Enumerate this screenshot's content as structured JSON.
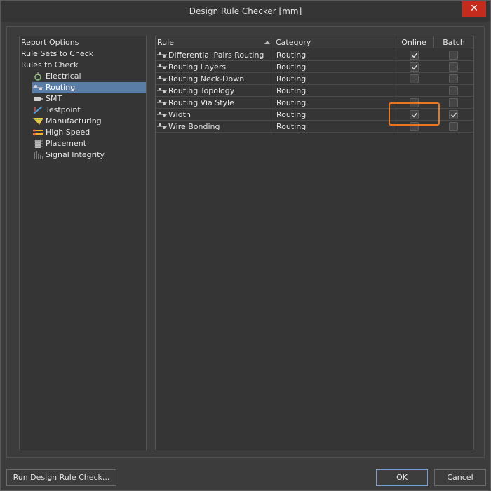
{
  "window": {
    "title": "Design Rule Checker [mm]",
    "close_label": "✕"
  },
  "tree": {
    "top_items": [
      {
        "label": "Report Options"
      },
      {
        "label": "Rule Sets to Check"
      },
      {
        "label": "Rules to Check"
      }
    ],
    "children": [
      {
        "label": "Electrical",
        "icon": "electrical-icon",
        "selected": false
      },
      {
        "label": "Routing",
        "icon": "routing-icon",
        "selected": true
      },
      {
        "label": "SMT",
        "icon": "smt-icon",
        "selected": false
      },
      {
        "label": "Testpoint",
        "icon": "testpoint-icon",
        "selected": false
      },
      {
        "label": "Manufacturing",
        "icon": "manufacturing-icon",
        "selected": false
      },
      {
        "label": "High Speed",
        "icon": "high-speed-icon",
        "selected": false
      },
      {
        "label": "Placement",
        "icon": "placement-icon",
        "selected": false
      },
      {
        "label": "Signal Integrity",
        "icon": "signal-integrity-icon",
        "selected": false
      }
    ]
  },
  "grid": {
    "columns": {
      "rule": "Rule",
      "category": "Category",
      "online": "Online",
      "batch": "Batch"
    },
    "rows": [
      {
        "rule": "Differential Pairs Routing",
        "category": "Routing",
        "online": true,
        "batch": false
      },
      {
        "rule": "Routing Layers",
        "category": "Routing",
        "online": true,
        "batch": false
      },
      {
        "rule": "Routing Neck-Down",
        "category": "Routing",
        "online": false,
        "batch": false
      },
      {
        "rule": "Routing Topology",
        "category": "Routing",
        "online": null,
        "batch": false
      },
      {
        "rule": "Routing Via Style",
        "category": "Routing",
        "online": false,
        "batch": false
      },
      {
        "rule": "Width",
        "category": "Routing",
        "online": true,
        "batch": true
      },
      {
        "rule": "Wire Bonding",
        "category": "Routing",
        "online": false,
        "batch": false
      }
    ]
  },
  "buttons": {
    "run": "Run Design Rule Check...",
    "ok": "OK",
    "cancel": "Cancel"
  },
  "colors": {
    "highlight": "#e87722",
    "selection": "#5a7da8",
    "close": "#c42b1c"
  }
}
